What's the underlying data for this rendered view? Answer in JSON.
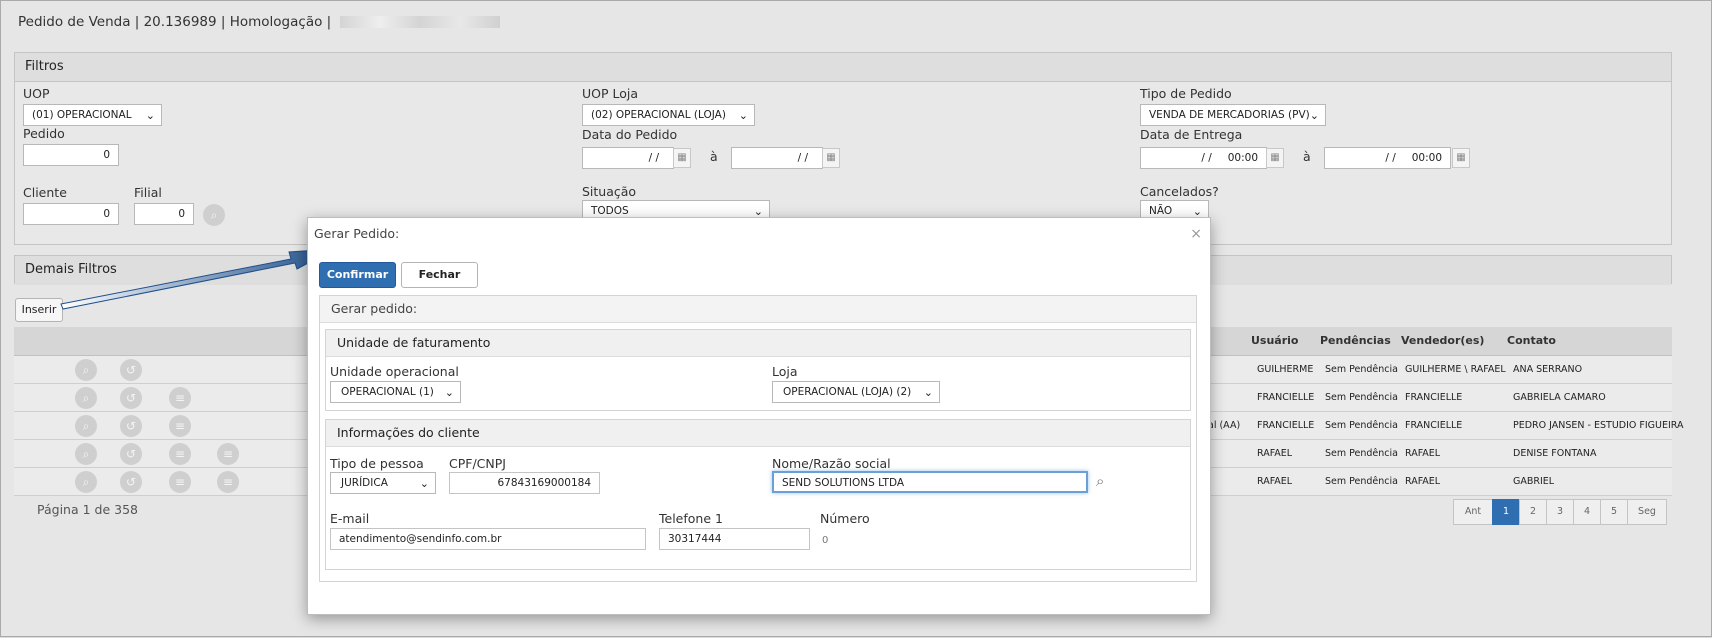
{
  "page": {
    "title": "Pedido de Venda | 20.136989 | Homologação |"
  },
  "filters": {
    "header": "Filtros",
    "uop_label": "UOP",
    "uop_value": "(01) OPERACIONAL",
    "uop_loja_label": "UOP Loja",
    "uop_loja_value": "(02) OPERACIONAL (LOJA)",
    "tipo_pedido_label": "Tipo de Pedido",
    "tipo_pedido_value": "VENDA DE MERCADORIAS (PV)",
    "pedido_label": "Pedido",
    "pedido_value": "0",
    "data_pedido_label": "Data do Pedido",
    "date_placeholder": "/ /",
    "a_label": "à",
    "data_entrega_label": "Data de Entrega",
    "datetime_placeholder": "/ /",
    "time_placeholder": "00:00",
    "cliente_label": "Cliente",
    "cliente_value": "0",
    "filial_label": "Filial",
    "filial_value": "0",
    "situacao_label": "Situação",
    "situacao_value": "TODOS",
    "cancelados_label": "Cancelados?",
    "cancelados_value": "NÃO"
  },
  "demais_filtros": {
    "header": "Demais Filtros"
  },
  "toolbar": {
    "inserir_label": "Inserir"
  },
  "table": {
    "headers": [
      "Usuário",
      "Pendências",
      "Vendedor(es)",
      "Contato"
    ],
    "rows": [
      {
        "partial": "",
        "usuario": "GUILHERME",
        "pendencias": "Sem Pendência",
        "vendedor": "GUILHERME \\ RAFAEL",
        "contato": "ANA SERRANO"
      },
      {
        "partial": "",
        "usuario": "FRANCIELLE",
        "pendencias": "Sem Pendência",
        "vendedor": "FRANCIELLE",
        "contato": "GABRIELA CAMARO"
      },
      {
        "partial": "al (AA)",
        "usuario": "FRANCIELLE",
        "pendencias": "Sem Pendência",
        "vendedor": "FRANCIELLE",
        "contato": "PEDRO JANSEN - ESTUDIO FIGUEIRA"
      },
      {
        "partial": "",
        "usuario": "RAFAEL",
        "pendencias": "Sem Pendência",
        "vendedor": "RAFAEL",
        "contato": "DENISE FONTANA"
      },
      {
        "partial": "",
        "usuario": "RAFAEL",
        "pendencias": "Sem Pendência",
        "vendedor": "RAFAEL",
        "contato": "GABRIEL"
      }
    ],
    "pagination_text": "Página 1 de 358",
    "pages": [
      "Ant",
      "1",
      "2",
      "3",
      "4",
      "5",
      "Seg"
    ],
    "active_page": "1"
  },
  "modal": {
    "title": "Gerar Pedido:",
    "close_symbol": "×",
    "confirm_label": "Confirmar",
    "close_label": "Fechar",
    "section_title": "Gerar pedido:",
    "faturamento": {
      "header": "Unidade de faturamento",
      "unidade_label": "Unidade operacional",
      "unidade_value": "OPERACIONAL (1)",
      "loja_label": "Loja",
      "loja_value": "OPERACIONAL (LOJA) (2)"
    },
    "cliente": {
      "header": "Informações do cliente",
      "tipo_label": "Tipo de pessoa",
      "tipo_value": "JURÍDICA",
      "cpf_label": "CPF/CNPJ",
      "cpf_value": "67843169000184",
      "nome_label": "Nome/Razão social",
      "nome_value": "SEND SOLUTIONS LTDA",
      "email_label": "E-mail",
      "email_value": "atendimento@sendinfo.com.br",
      "telefone_label": "Telefone 1",
      "telefone_value": "30317444",
      "numero_label": "Número",
      "numero_value": "0"
    }
  },
  "colors": {
    "primary": "#2f6fb1",
    "arrow": "#1f4f8a",
    "focus": "#6aa0d6"
  }
}
